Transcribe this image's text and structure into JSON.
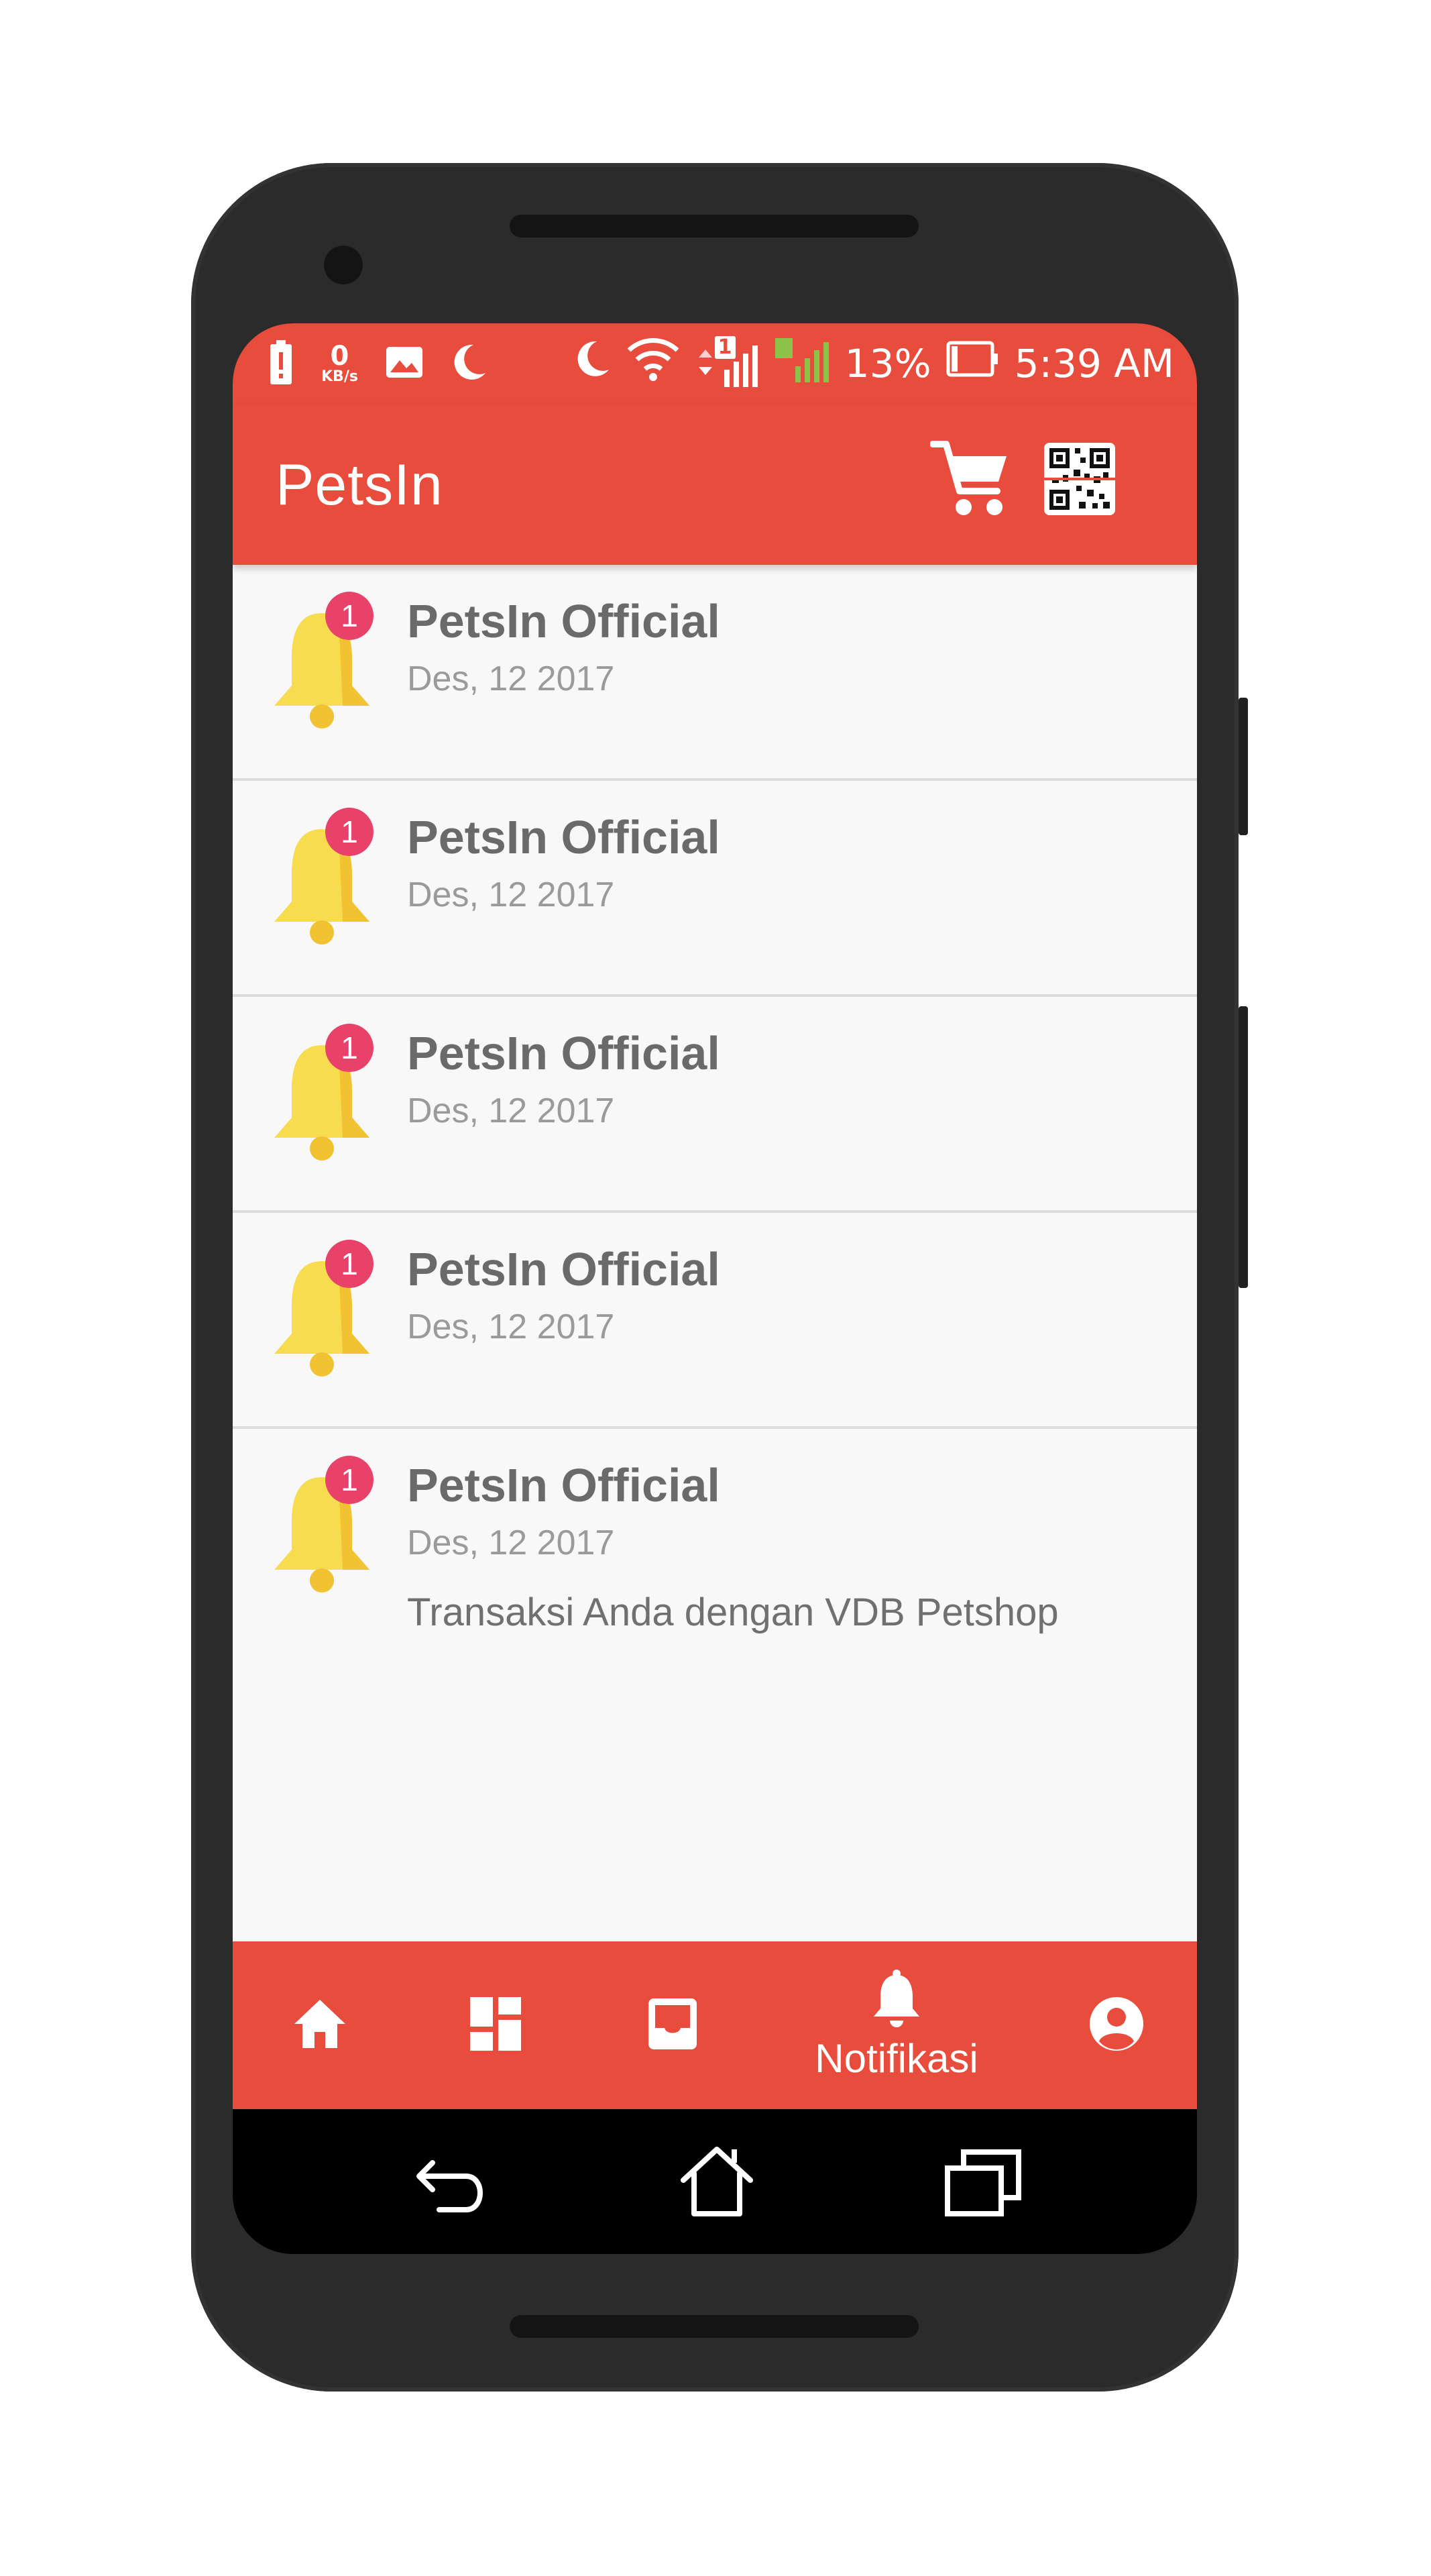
{
  "status_bar": {
    "net_speed_value": "0",
    "net_speed_unit": "KB/s",
    "sim_badge": "1",
    "battery_percent": "13%",
    "time": "5:39 AM"
  },
  "app_bar": {
    "title": "PetsIn",
    "cart_icon": "shopping-cart-icon",
    "qr_icon": "qr-code-icon"
  },
  "notifications": [
    {
      "badge": "1",
      "sender": "PetsIn Official",
      "date": "Des, 12 2017"
    },
    {
      "badge": "1",
      "sender": "PetsIn Official",
      "date": "Des, 12 2017"
    },
    {
      "badge": "1",
      "sender": "PetsIn Official",
      "date": "Des, 12 2017"
    },
    {
      "badge": "1",
      "sender": "PetsIn Official",
      "date": "Des, 12 2017"
    },
    {
      "badge": "1",
      "sender": "PetsIn Official",
      "date": "Des, 12 2017",
      "message": "Transaksi Anda dengan VDB Petshop"
    }
  ],
  "bottom_nav": {
    "items": [
      {
        "icon": "home-icon"
      },
      {
        "icon": "dashboard-icon"
      },
      {
        "icon": "inbox-icon"
      },
      {
        "icon": "bell-icon",
        "label": "Notifikasi",
        "active": true
      },
      {
        "icon": "account-icon"
      }
    ]
  },
  "colors": {
    "primary": "#e74c3c",
    "list_background": "#f8f8f8",
    "bell_yellow": "#f7dc50",
    "badge_pink": "#e8416a"
  }
}
